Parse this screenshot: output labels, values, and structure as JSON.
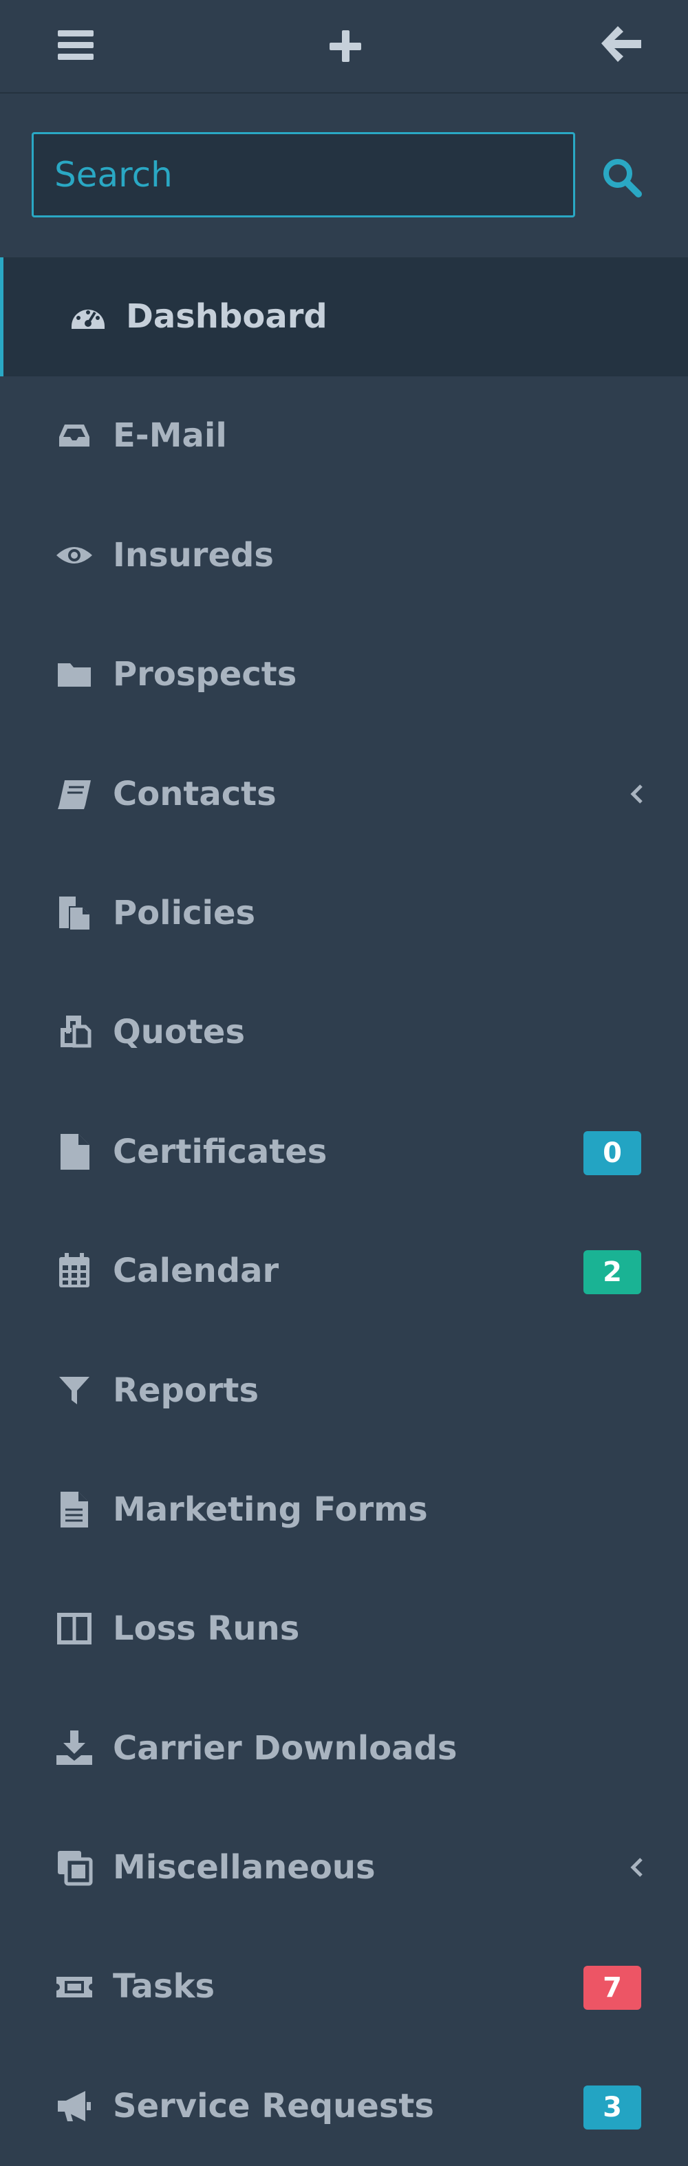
{
  "search": {
    "placeholder": "Search"
  },
  "menu": [
    {
      "label": "Dashboard",
      "icon": "dashboard-icon",
      "active": true
    },
    {
      "label": "E-Mail",
      "icon": "inbox-icon"
    },
    {
      "label": "Insureds",
      "icon": "eye-icon"
    },
    {
      "label": "Prospects",
      "icon": "folder-icon"
    },
    {
      "label": "Contacts",
      "icon": "book-icon",
      "submenu": true
    },
    {
      "label": "Policies",
      "icon": "files-icon"
    },
    {
      "label": "Quotes",
      "icon": "copy-icon"
    },
    {
      "label": "Certificates",
      "icon": "file-icon",
      "badge": "0",
      "badge_color": "#23a4c3"
    },
    {
      "label": "Calendar",
      "icon": "calendar-icon",
      "badge": "2",
      "badge_color": "#1ab394"
    },
    {
      "label": "Reports",
      "icon": "filter-icon"
    },
    {
      "label": "Marketing Forms",
      "icon": "file-text-icon"
    },
    {
      "label": "Loss Runs",
      "icon": "columns-icon"
    },
    {
      "label": "Carrier Downloads",
      "icon": "download-icon"
    },
    {
      "label": "Miscellaneous",
      "icon": "clone-icon",
      "submenu": true
    },
    {
      "label": "Tasks",
      "icon": "ticket-icon",
      "badge": "7",
      "badge_color": "#ed5565"
    },
    {
      "label": "Service Requests",
      "icon": "bullhorn-icon",
      "badge": "3",
      "badge_color": "#23a4c3"
    }
  ],
  "colors": {
    "background": "#2f3e4e",
    "active_background": "#243341",
    "accent": "#2aa8c4",
    "text": "#a9b4c0"
  }
}
